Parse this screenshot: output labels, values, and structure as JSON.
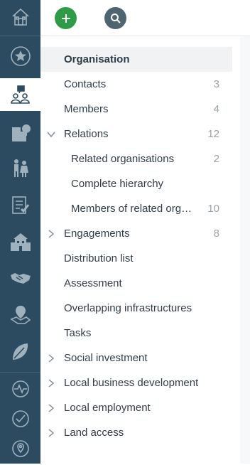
{
  "rail": {
    "items": [
      {
        "icon": "home-icon"
      },
      {
        "icon": "star-icon"
      },
      {
        "icon": "stakeholders-icon"
      },
      {
        "icon": "organisation-building-icon"
      },
      {
        "icon": "people-icon"
      },
      {
        "icon": "checklist-icon"
      },
      {
        "icon": "facility-building-icon"
      },
      {
        "icon": "handshake-icon"
      },
      {
        "icon": "map-pin-land-icon"
      },
      {
        "icon": "leaf-icon"
      },
      {
        "icon": "activity-pulse-icon"
      },
      {
        "icon": "check-circle-icon"
      },
      {
        "icon": "location-icon"
      }
    ]
  },
  "toolbar": {
    "add_icon": "plus-icon",
    "search_icon": "search-icon"
  },
  "nav": {
    "items": [
      {
        "label": "Organisation",
        "count": ""
      },
      {
        "label": "Contacts",
        "count": "3"
      },
      {
        "label": "Members",
        "count": "4"
      },
      {
        "label": "Relations",
        "count": "12"
      },
      {
        "label": "Related organisations",
        "count": "2"
      },
      {
        "label": "Complete hierarchy",
        "count": ""
      },
      {
        "label": "Members of related org…",
        "count": "10"
      },
      {
        "label": "Engagements",
        "count": "8"
      },
      {
        "label": "Distribution list",
        "count": ""
      },
      {
        "label": "Assessment",
        "count": ""
      },
      {
        "label": "Overlapping infrastructures",
        "count": ""
      },
      {
        "label": "Tasks",
        "count": ""
      },
      {
        "label": "Social investment",
        "count": ""
      },
      {
        "label": "Local business development",
        "count": ""
      },
      {
        "label": "Local employment",
        "count": ""
      },
      {
        "label": "Land access",
        "count": ""
      }
    ]
  },
  "colors": {
    "rail": "#2d4b60",
    "accent_green": "#2f9a47",
    "search_button": "#4e6470",
    "selected_row": "#f1f2f3"
  }
}
